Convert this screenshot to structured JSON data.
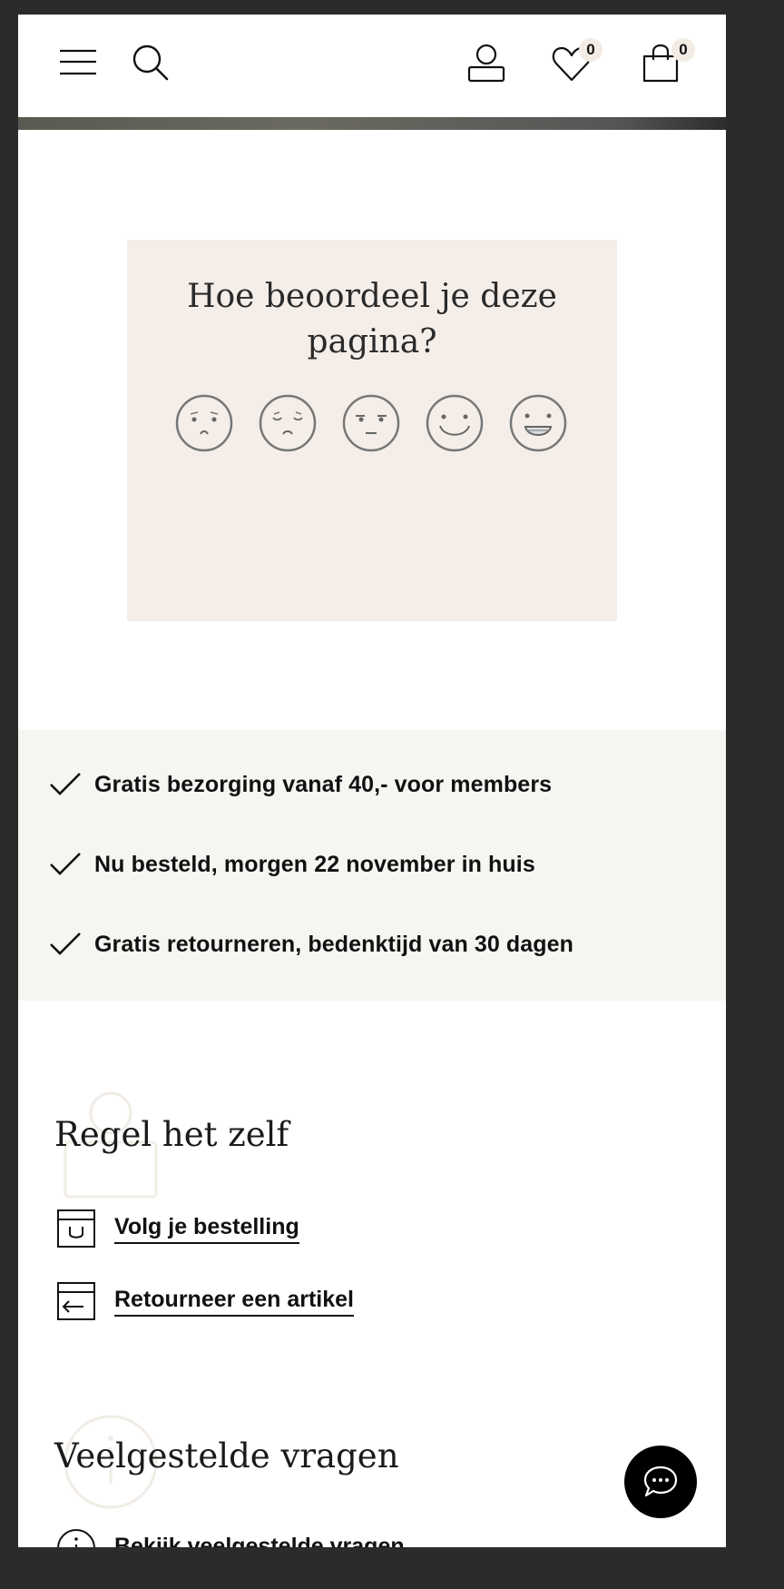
{
  "header": {
    "wishlist_count": "0",
    "cart_count": "0"
  },
  "rating": {
    "title": "Hoe beoordeel je deze pagina?",
    "faces": [
      "very-unhappy-face-icon",
      "unhappy-face-icon",
      "neutral-face-icon",
      "happy-face-icon",
      "very-happy-face-icon"
    ]
  },
  "usps": [
    {
      "text": "Gratis bezorging vanaf 40,- voor members"
    },
    {
      "text": "Nu besteld, morgen 22 november in huis"
    },
    {
      "text": "Gratis retourneren, bedenktijd van 30 dagen"
    }
  ],
  "self_service": {
    "title": "Regel het zelf",
    "links": [
      {
        "label": "Volg je bestelling",
        "icon": "package-track-icon"
      },
      {
        "label": "Retourneer een artikel",
        "icon": "return-box-icon"
      }
    ]
  },
  "faq": {
    "title": "Veelgestelde vragen",
    "link_label": "Bekijk veelgestelde vragen"
  },
  "colors": {
    "page_bg": "#2b2b2b",
    "rating_card_bg": "#f5eee8",
    "usp_band_bg": "#f7f5f2",
    "badge_bg": "#f3ece4",
    "chat_button_bg": "#000000"
  }
}
